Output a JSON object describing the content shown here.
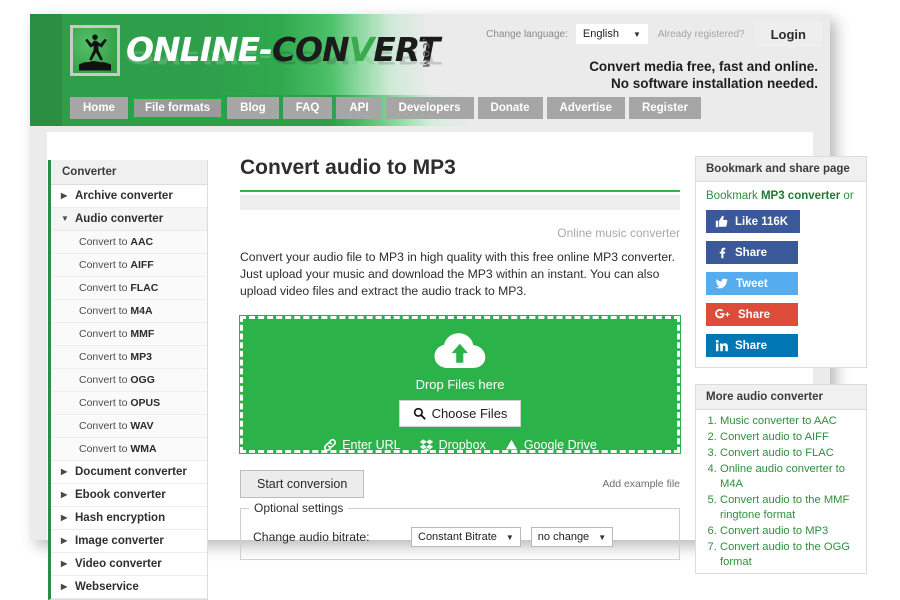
{
  "header": {
    "logo_part1": "ONLINE-",
    "logo_part2a": "CON",
    "logo_part2v": "V",
    "logo_part2b": "ERT",
    "logo_dotcom": ".COM",
    "change_language_label": "Change language:",
    "language_value": "English",
    "already_registered": "Already registered?",
    "login_label": "Login",
    "tagline_line1": "Convert media free, fast and online.",
    "tagline_line2": "No software installation needed."
  },
  "nav": {
    "items": [
      {
        "label": "Home",
        "active": false
      },
      {
        "label": "File formats",
        "active": true
      },
      {
        "label": "Blog",
        "active": false
      },
      {
        "label": "FAQ",
        "active": false
      },
      {
        "label": "API",
        "active": false
      },
      {
        "label": "Developers",
        "active": false
      },
      {
        "label": "Donate",
        "active": false
      },
      {
        "label": "Advertise",
        "active": false
      },
      {
        "label": "Register",
        "active": false
      }
    ]
  },
  "sidebar": {
    "heading": "Converter",
    "groups": [
      {
        "label": "Archive converter",
        "open": false,
        "children": []
      },
      {
        "label": "Audio converter",
        "open": true,
        "children": [
          {
            "prefix": "Convert to ",
            "format": "AAC"
          },
          {
            "prefix": "Convert to ",
            "format": "AIFF"
          },
          {
            "prefix": "Convert to ",
            "format": "FLAC"
          },
          {
            "prefix": "Convert to ",
            "format": "M4A"
          },
          {
            "prefix": "Convert to ",
            "format": "MMF"
          },
          {
            "prefix": "Convert to ",
            "format": "MP3"
          },
          {
            "prefix": "Convert to ",
            "format": "OGG"
          },
          {
            "prefix": "Convert to ",
            "format": "OPUS"
          },
          {
            "prefix": "Convert to ",
            "format": "WAV"
          },
          {
            "prefix": "Convert to ",
            "format": "WMA"
          }
        ]
      },
      {
        "label": "Document converter",
        "open": false,
        "children": []
      },
      {
        "label": "Ebook converter",
        "open": false,
        "children": []
      },
      {
        "label": "Hash encryption",
        "open": false,
        "children": []
      },
      {
        "label": "Image converter",
        "open": false,
        "children": []
      },
      {
        "label": "Video converter",
        "open": false,
        "children": []
      },
      {
        "label": "Webservice",
        "open": false,
        "children": []
      }
    ]
  },
  "main": {
    "title": "Convert audio to MP3",
    "subnote": "Online music converter",
    "blurb": "Convert your audio file to MP3 in high quality with this free online MP3 converter. Just upload your music and download the MP3 within an instant. You can also upload video files and extract the audio track to MP3.",
    "dropzone": {
      "drop_label": "Drop Files here",
      "choose_files_label": "Choose Files",
      "enter_url_label": "Enter URL",
      "dropbox_label": "Dropbox",
      "google_drive_label": "Google Drive"
    },
    "start_button": "Start conversion",
    "add_example_link": "Add example file",
    "optional_settings_legend": "Optional settings",
    "bitrate_label": "Change audio bitrate:",
    "bitrate_mode_value": "Constant Bitrate",
    "bitrate_value": "no change"
  },
  "right": {
    "share_heading": "Bookmark and share page",
    "bookmark_prefix": "Bookmark ",
    "bookmark_bold": "MP3 converter",
    "bookmark_suffix": " or",
    "social_buttons": [
      {
        "label": "Like 116K",
        "color": "#3b5998",
        "icon": "thumbs-up"
      },
      {
        "label": "Share",
        "color": "#3b5998",
        "icon": "facebook"
      },
      {
        "label": "Tweet",
        "color": "#55acee",
        "icon": "twitter"
      },
      {
        "label": "Share",
        "color": "#dd4b39",
        "icon": "google-plus"
      },
      {
        "label": "Share",
        "color": "#0077b5",
        "icon": "linkedin"
      }
    ],
    "more_heading": "More audio converter",
    "more_items": [
      "Music converter to AAC",
      "Convert audio to AIFF",
      "Convert audio to FLAC",
      "Online audio converter to M4A",
      "Convert audio to the MMF ringtone format",
      "Convert audio to MP3",
      "Convert audio to the OGG format"
    ]
  },
  "colors": {
    "brand_green": "#2bb34a",
    "header_green": "#2e9e4a",
    "link_green": "#2f8f3e",
    "nav_gray": "#a6a6a6"
  }
}
